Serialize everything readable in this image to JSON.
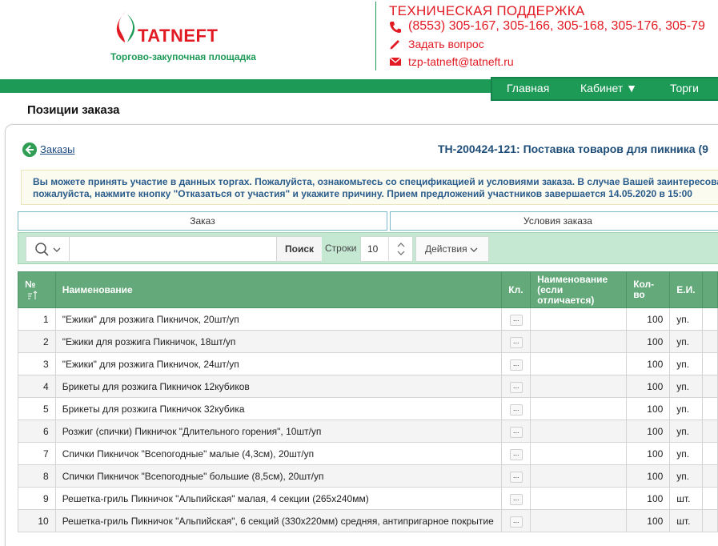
{
  "brand": {
    "name": "TATNEFT",
    "subtitle": "Торгово-закупочная площадка"
  },
  "support": {
    "title": "ТЕХНИЧЕСКАЯ ПОДДЕРЖКА",
    "phone": "(8553) 305-167, 305-166, 305-168, 305-176, 305-79",
    "ask": "Задать вопрос",
    "email": "tzp-tatneft@tatneft.ru"
  },
  "nav": {
    "home": "Главная",
    "cabinet": "Кабинет ▼",
    "trades": "Торги"
  },
  "page_title": "Позиции заказа",
  "back_label": "Заказы",
  "order_title": "ТН-200424-121: Поставка товаров для пикника (9",
  "notice": {
    "line1": "Вы можете принять участие в данных торгах. Пожалуйста, ознакомьтесь со спецификацией и условиями заказа. В случае Вашей заинтересова",
    "line2": "пожалуйста, нажмите кнопку \"Отказаться от участия\" и укажите причину. Прием предложений участников завершается 14.05.2020 в 15:00"
  },
  "tabs": {
    "order": "Заказ",
    "terms": "Условия заказа"
  },
  "toolbar": {
    "search_placeholder": "",
    "search_button": "Поиск",
    "rows_label": "Строки",
    "rows_value": "10",
    "actions": "Действия"
  },
  "table": {
    "headers": {
      "num": "№",
      "name": "Наименование",
      "cl": "Кл.",
      "alt_name": "Наименование (если отличается)",
      "qty": "Кол-во",
      "unit": "Е.И."
    },
    "rows": [
      {
        "num": "1",
        "name": "\"Ежики\" для розжига Пикничок, 20шт/уп",
        "qty": "100",
        "unit": "уп."
      },
      {
        "num": "2",
        "name": "\"Ежики для розжига Пикничок, 18шт/уп",
        "qty": "100",
        "unit": "уп."
      },
      {
        "num": "3",
        "name": "\"Ежики\" для розжига Пикничок, 24шт/уп",
        "qty": "100",
        "unit": "уп."
      },
      {
        "num": "4",
        "name": "Брикеты для розжига Пикничок 12кубиков",
        "qty": "100",
        "unit": "уп."
      },
      {
        "num": "5",
        "name": "Брикеты для розжига Пикничок 32кубика",
        "qty": "100",
        "unit": "уп."
      },
      {
        "num": "6",
        "name": "Розжиг (спички) Пикничок \"Длительного горения\", 10шт/уп",
        "qty": "100",
        "unit": "уп."
      },
      {
        "num": "7",
        "name": "Спички Пикничок \"Всепогодные\" малые (4,3см), 20шт/уп",
        "qty": "100",
        "unit": "уп."
      },
      {
        "num": "8",
        "name": "Спички Пикничок \"Всепогодные\" большие (8,5см), 20шт/уп",
        "qty": "100",
        "unit": "уп."
      },
      {
        "num": "9",
        "name": "Решетка-гриль Пикничок \"Альпийская\" малая, 4 секции (265x240мм)",
        "qty": "100",
        "unit": "шт."
      },
      {
        "num": "10",
        "name": "Решетка-гриль Пикничок \"Альпийская\", 6 секций (330x220мм) средняя, антипригарное покрытие",
        "qty": "100",
        "unit": "шт."
      }
    ],
    "more_button": "..."
  },
  "colors": {
    "brand_red": "#e21a23",
    "brand_green": "#1e9a57",
    "table_header": "#64a97a",
    "toolbar_bg": "#c5e8d2"
  }
}
